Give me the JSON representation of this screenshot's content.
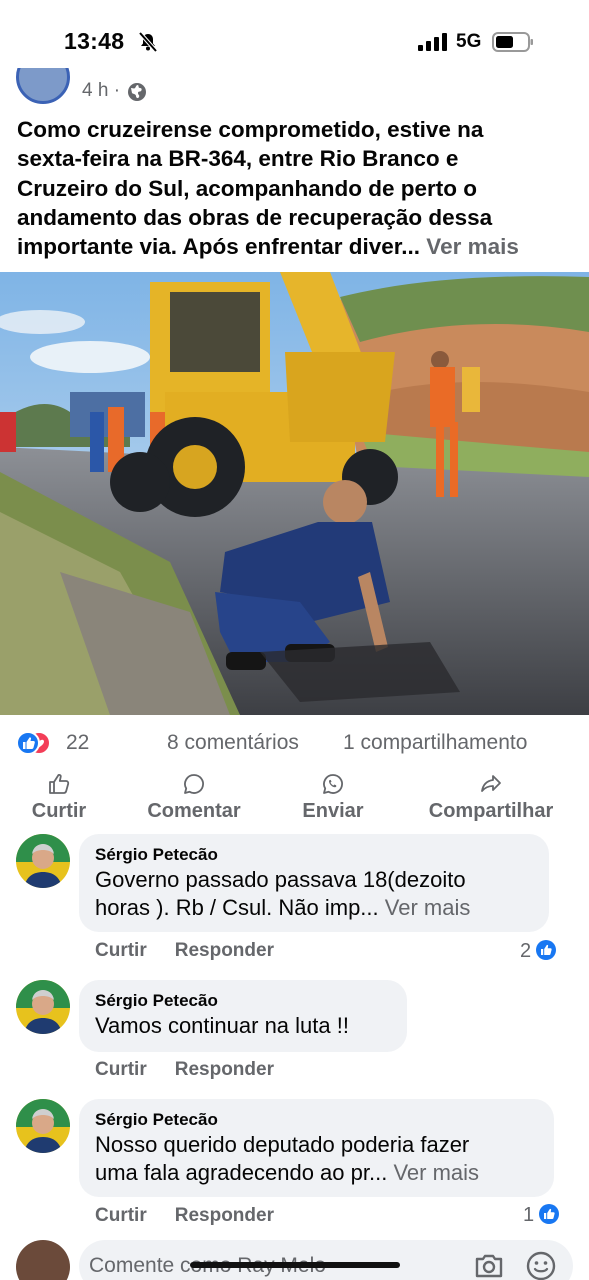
{
  "status_bar": {
    "time": "13:48",
    "network": "5G"
  },
  "post": {
    "time": "4 h ·",
    "text_lines": [
      "Como cruzeirense comprometido, estive na",
      "sexta-feira na BR-364, entre Rio Branco e",
      "Cruzeiro do Sul, acompanhando de perto o",
      "andamento das obras de recuperação dessa"
    ],
    "last_line": "importante via. Após enfrentar diver...",
    "see_more": "Ver mais"
  },
  "stats": {
    "reactions": "22",
    "comments": "8 comentários",
    "shares": "1 compartilhamento"
  },
  "actions": {
    "like": "Curtir",
    "comment": "Comentar",
    "send": "Enviar",
    "share": "Compartilhar"
  },
  "comments": [
    {
      "author": "Sérgio Petecão",
      "line1": "Governo passado passava 18(dezoito",
      "line2": "horas ).  Rb / Csul.  Não imp...",
      "more": "Ver mais",
      "like": "Curtir",
      "reply": "Responder",
      "likes": "2"
    },
    {
      "author": "Sérgio Petecão",
      "line1": "Vamos continuar na luta !!",
      "like": "Curtir",
      "reply": "Responder"
    },
    {
      "author": "Sérgio Petecão",
      "line1": "Nosso querido deputado poderia fazer",
      "line2": "uma fala agradecendo ao pr...",
      "more": "Ver mais",
      "like": "Curtir",
      "reply": "Responder",
      "likes": "1"
    }
  ],
  "composer": {
    "placeholder": "Comente como Ray Melo"
  },
  "colors": {
    "brand_blue": "#1877f2",
    "love_red": "#f33e58",
    "muted": "#65676b",
    "bubble": "#f0f2f5"
  }
}
